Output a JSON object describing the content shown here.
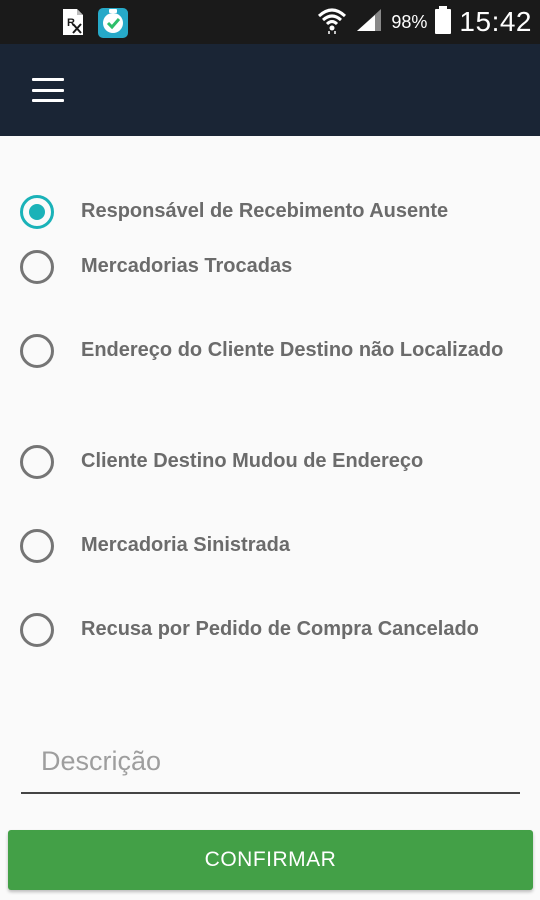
{
  "status_bar": {
    "icons_left": [
      "rx-notification-icon",
      "shield-check-app-icon"
    ],
    "icons_right": [
      "wifi-icon",
      "signal-icon",
      "battery-icon"
    ],
    "battery_pct": "98%",
    "time": "15:42"
  },
  "app_bar": {
    "menu_icon": "hamburger-menu-icon",
    "background": "#1a2535"
  },
  "options": [
    {
      "label": "Responsável de Recebimento Ausente",
      "checked": true
    },
    {
      "label": "Mercadorias Trocadas",
      "checked": false
    },
    {
      "label": "Endereço do Cliente Destino não Localizado",
      "checked": false
    },
    {
      "label": "Cliente Destino Mudou de Endereço",
      "checked": false
    },
    {
      "label": "Mercadoria Sinistrada",
      "checked": false
    },
    {
      "label": "Recusa por Pedido de Compra Cancelado",
      "checked": false
    }
  ],
  "description": {
    "placeholder": "Descrição",
    "value": ""
  },
  "confirm": {
    "label": "CONFIRMAR",
    "color": "#43a047"
  },
  "colors": {
    "accent": "#1ab2b8",
    "radio_unchecked": "#757575",
    "label_text": "#6b6b6b"
  }
}
